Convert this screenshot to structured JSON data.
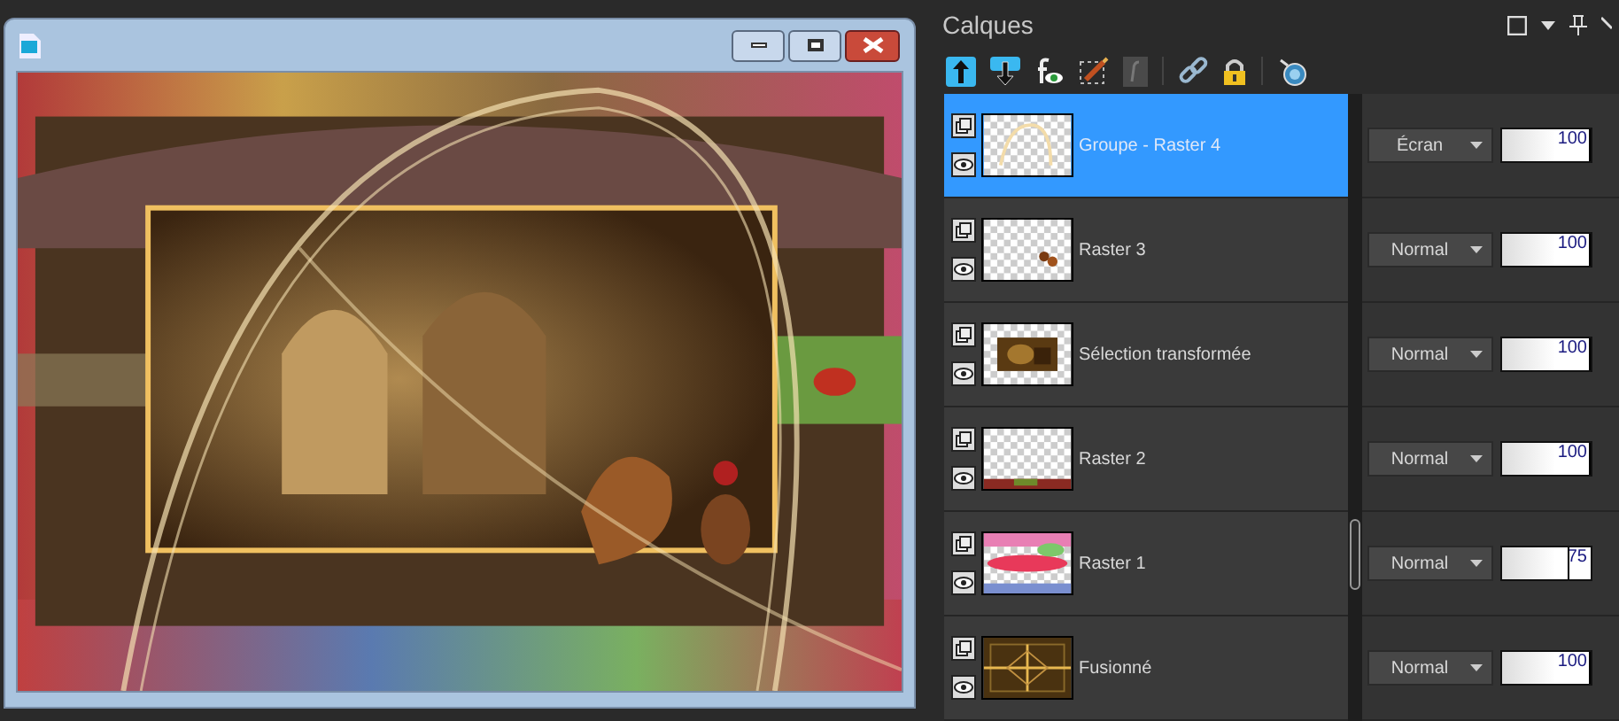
{
  "panel": {
    "title": "Calques"
  },
  "layers": [
    {
      "name": "Groupe - Raster 4",
      "selected": true,
      "blend": "Écran",
      "opacity": "100",
      "level": 1
    },
    {
      "name": "Raster 3",
      "selected": false,
      "blend": "Normal",
      "opacity": "100",
      "level": 1
    },
    {
      "name": "Sélection transformée",
      "selected": false,
      "blend": "Normal",
      "opacity": "100",
      "level": 1
    },
    {
      "name": "Raster 2",
      "selected": false,
      "blend": "Normal",
      "opacity": "100",
      "level": 1
    },
    {
      "name": "Raster 1",
      "selected": false,
      "blend": "Normal",
      "opacity": "75",
      "level": 0.75
    },
    {
      "name": "Fusionné",
      "selected": false,
      "blend": "Normal",
      "opacity": "100",
      "level": 1
    }
  ]
}
